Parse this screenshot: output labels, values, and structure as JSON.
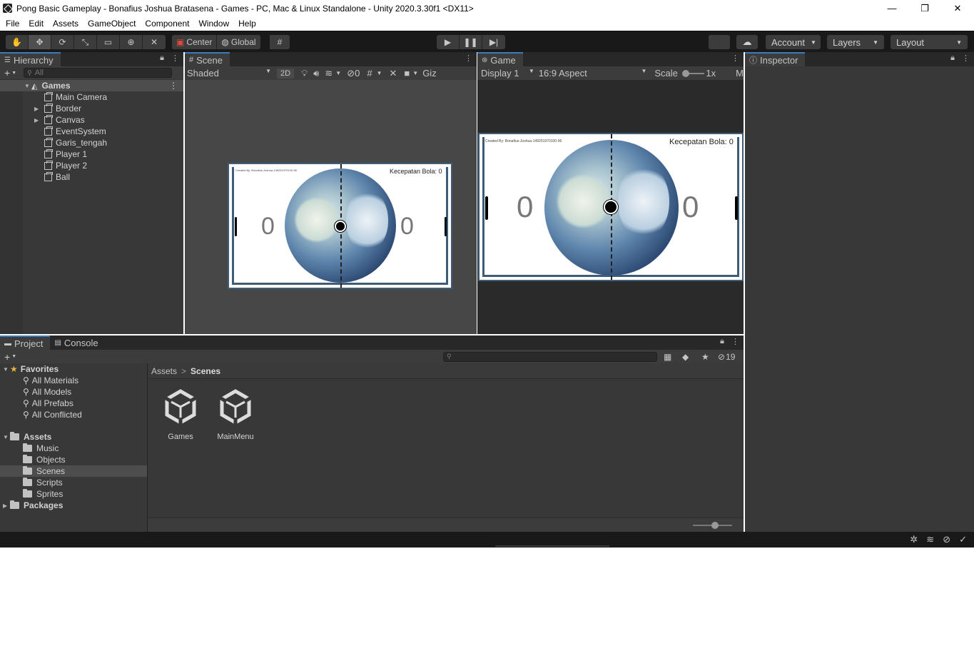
{
  "window": {
    "title": "Pong Basic Gameplay - Bonafius Joshua Bratasena - Games - PC, Mac & Linux Standalone - Unity 2020.3.30f1 <DX11>",
    "minimize": "—",
    "maximize": "❐",
    "close": "✕"
  },
  "menu": [
    "File",
    "Edit",
    "Assets",
    "GameObject",
    "Component",
    "Window",
    "Help"
  ],
  "toolbar": {
    "pivot_mode": "Center",
    "pivot_rotation": "Global",
    "account_label": "Account",
    "layers_label": "Layers",
    "layout_label": "Layout"
  },
  "hierarchy": {
    "tab_label": "Hierarchy",
    "search_placeholder": "All",
    "scene_name": "Games",
    "items": [
      "Main Camera",
      "Border",
      "Canvas",
      "EventSystem",
      "Garis_tengah",
      "Player 1",
      "Player 2",
      "Ball"
    ]
  },
  "scene": {
    "tab_label": "Scene",
    "shading_mode": "Shaded",
    "toggle_2d": "2D",
    "hidden_count": "0",
    "gizmos_label": "Giz"
  },
  "game": {
    "tab_label": "Game",
    "display": "Display 1",
    "aspect": "16:9 Aspect",
    "scale_label": "Scale",
    "scale_value": "1x",
    "maximize_label": "M",
    "credit_text": "Created By: Bonafius-Joshua-149251970100-96",
    "speed_text": "Kecepatan Bola: 0",
    "score_left": "0",
    "score_right": "0"
  },
  "inspector": {
    "tab_label": "Inspector"
  },
  "project": {
    "tab_project": "Project",
    "tab_console": "Console",
    "hidden_packages_count": "19",
    "favorites_label": "Favorites",
    "favorites": [
      "All Materials",
      "All Models",
      "All Prefabs",
      "All Conflicted"
    ],
    "assets_label": "Assets",
    "asset_folders": [
      "Music",
      "Objects",
      "Scenes",
      "Scripts",
      "Sprites"
    ],
    "packages_label": "Packages",
    "breadcrumb": [
      "Assets",
      "Scenes"
    ],
    "breadcrumb_sep": ">",
    "scene_assets": [
      "Games",
      "MainMenu"
    ]
  }
}
